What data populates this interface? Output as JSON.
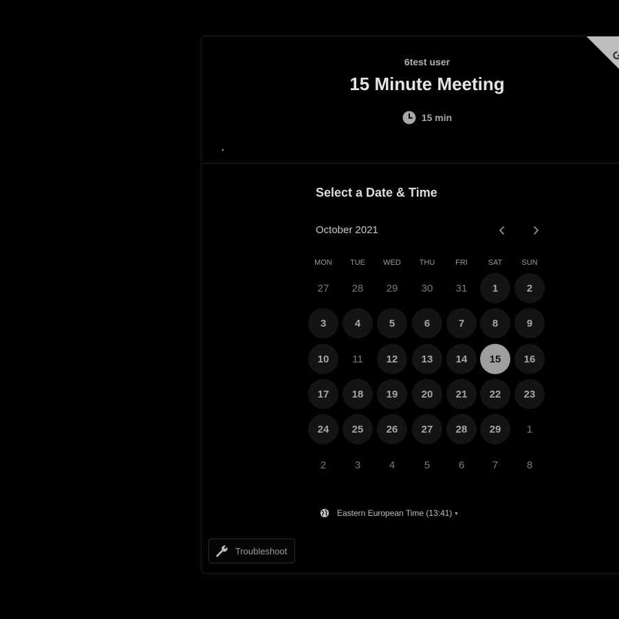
{
  "event": {
    "owner_name": "6test user",
    "title": "15 Minute Meeting",
    "duration": "15 min",
    "clock_icon": "clock-icon"
  },
  "scheduler": {
    "section_title": "Select a Date & Time",
    "month_label": "October 2021",
    "prev_icon": "chevron-left-icon",
    "next_icon": "chevron-right-icon",
    "weekdays": [
      "MON",
      "TUE",
      "WED",
      "THU",
      "FRI",
      "SAT",
      "SUN"
    ],
    "weeks": [
      [
        {
          "d": "27",
          "s": "muted"
        },
        {
          "d": "28",
          "s": "muted"
        },
        {
          "d": "29",
          "s": "muted"
        },
        {
          "d": "30",
          "s": "muted"
        },
        {
          "d": "31",
          "s": "muted"
        },
        {
          "d": "1",
          "s": "avail"
        },
        {
          "d": "2",
          "s": "avail"
        }
      ],
      [
        {
          "d": "3",
          "s": "avail"
        },
        {
          "d": "4",
          "s": "avail"
        },
        {
          "d": "5",
          "s": "avail"
        },
        {
          "d": "6",
          "s": "avail"
        },
        {
          "d": "7",
          "s": "avail"
        },
        {
          "d": "8",
          "s": "avail"
        },
        {
          "d": "9",
          "s": "avail"
        }
      ],
      [
        {
          "d": "10",
          "s": "avail"
        },
        {
          "d": "11",
          "s": "muted"
        },
        {
          "d": "12",
          "s": "avail"
        },
        {
          "d": "13",
          "s": "avail"
        },
        {
          "d": "14",
          "s": "avail"
        },
        {
          "d": "15",
          "s": "selected"
        },
        {
          "d": "16",
          "s": "avail"
        }
      ],
      [
        {
          "d": "17",
          "s": "avail"
        },
        {
          "d": "18",
          "s": "avail"
        },
        {
          "d": "19",
          "s": "avail"
        },
        {
          "d": "20",
          "s": "avail"
        },
        {
          "d": "21",
          "s": "avail"
        },
        {
          "d": "22",
          "s": "avail"
        },
        {
          "d": "23",
          "s": "avail"
        }
      ],
      [
        {
          "d": "24",
          "s": "avail"
        },
        {
          "d": "25",
          "s": "avail"
        },
        {
          "d": "26",
          "s": "avail"
        },
        {
          "d": "27",
          "s": "avail"
        },
        {
          "d": "28",
          "s": "avail"
        },
        {
          "d": "29",
          "s": "avail"
        },
        {
          "d": "1",
          "s": "muted"
        }
      ],
      [
        {
          "d": "2",
          "s": "muted"
        },
        {
          "d": "3",
          "s": "muted"
        },
        {
          "d": "4",
          "s": "muted"
        },
        {
          "d": "5",
          "s": "muted"
        },
        {
          "d": "6",
          "s": "muted"
        },
        {
          "d": "7",
          "s": "muted"
        },
        {
          "d": "8",
          "s": "muted"
        }
      ]
    ],
    "timezone_label": "Eastern European Time (13:41)",
    "timezone_icon": "globe-icon"
  },
  "footer": {
    "troubleshoot_label": "Troubleshoot",
    "troubleshoot_icon": "wrench-icon"
  },
  "colors": {
    "background": "#000000",
    "selected_day": "#9e9e9e",
    "available_day": "#141414"
  }
}
